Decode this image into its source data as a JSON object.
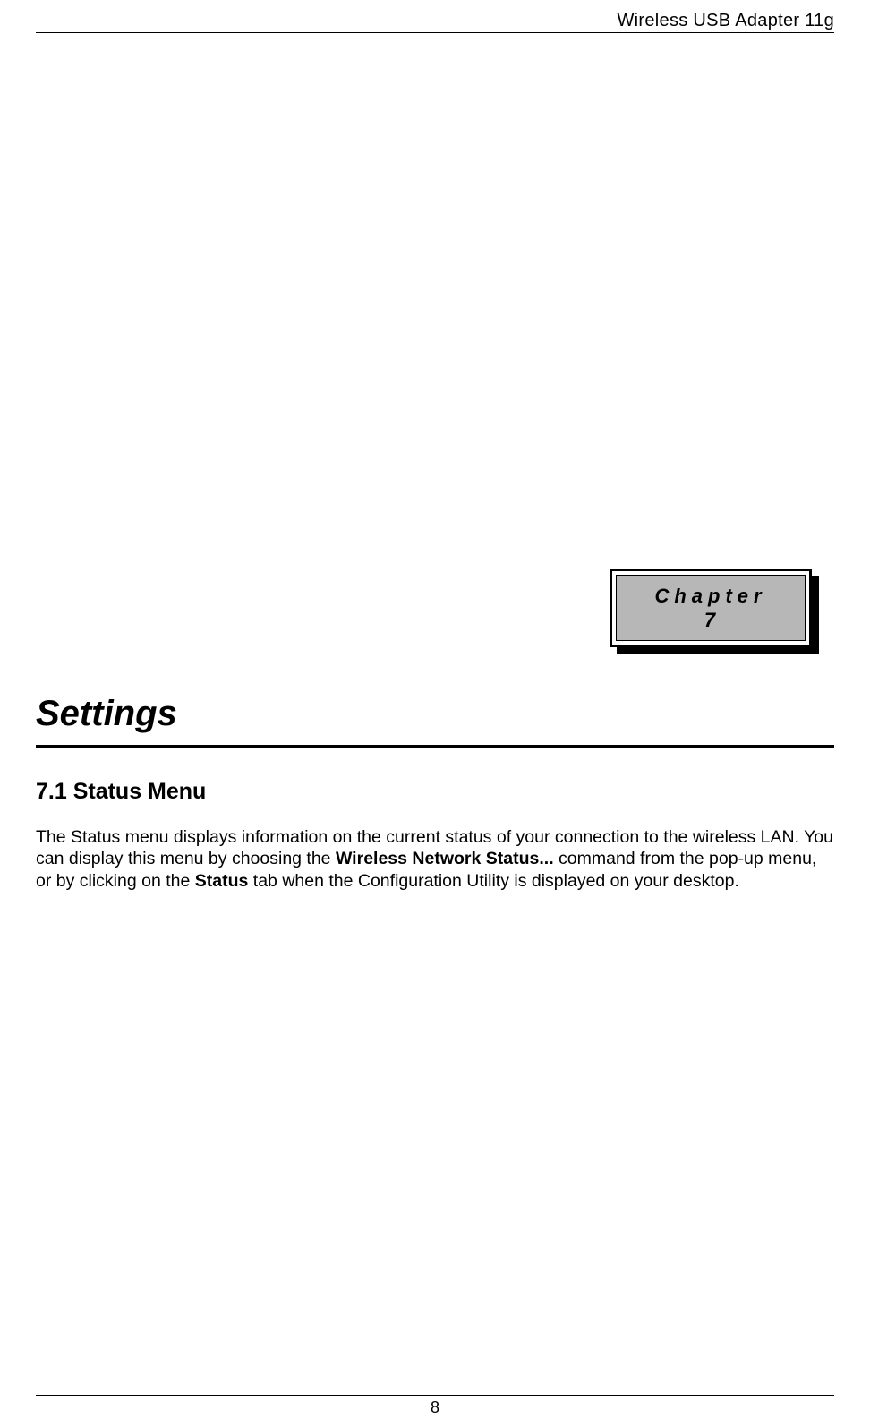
{
  "header": {
    "product_name": "Wireless USB Adapter 11g"
  },
  "chapter_box": {
    "label": "Chapter",
    "number": "7"
  },
  "main_title": "Settings",
  "section": {
    "heading": "7.1 Status Menu",
    "paragraph": {
      "part1": "The Status menu displays information on the current status of your connection to the wireless LAN. You can display this menu by choosing the ",
      "bold1": "Wireless Network Status...",
      "part2": " command from the pop-up menu, or by clicking on the ",
      "bold2": "Status",
      "part3": " tab when the Configuration Utility is displayed on your desktop."
    }
  },
  "footer": {
    "page_number": "8"
  }
}
